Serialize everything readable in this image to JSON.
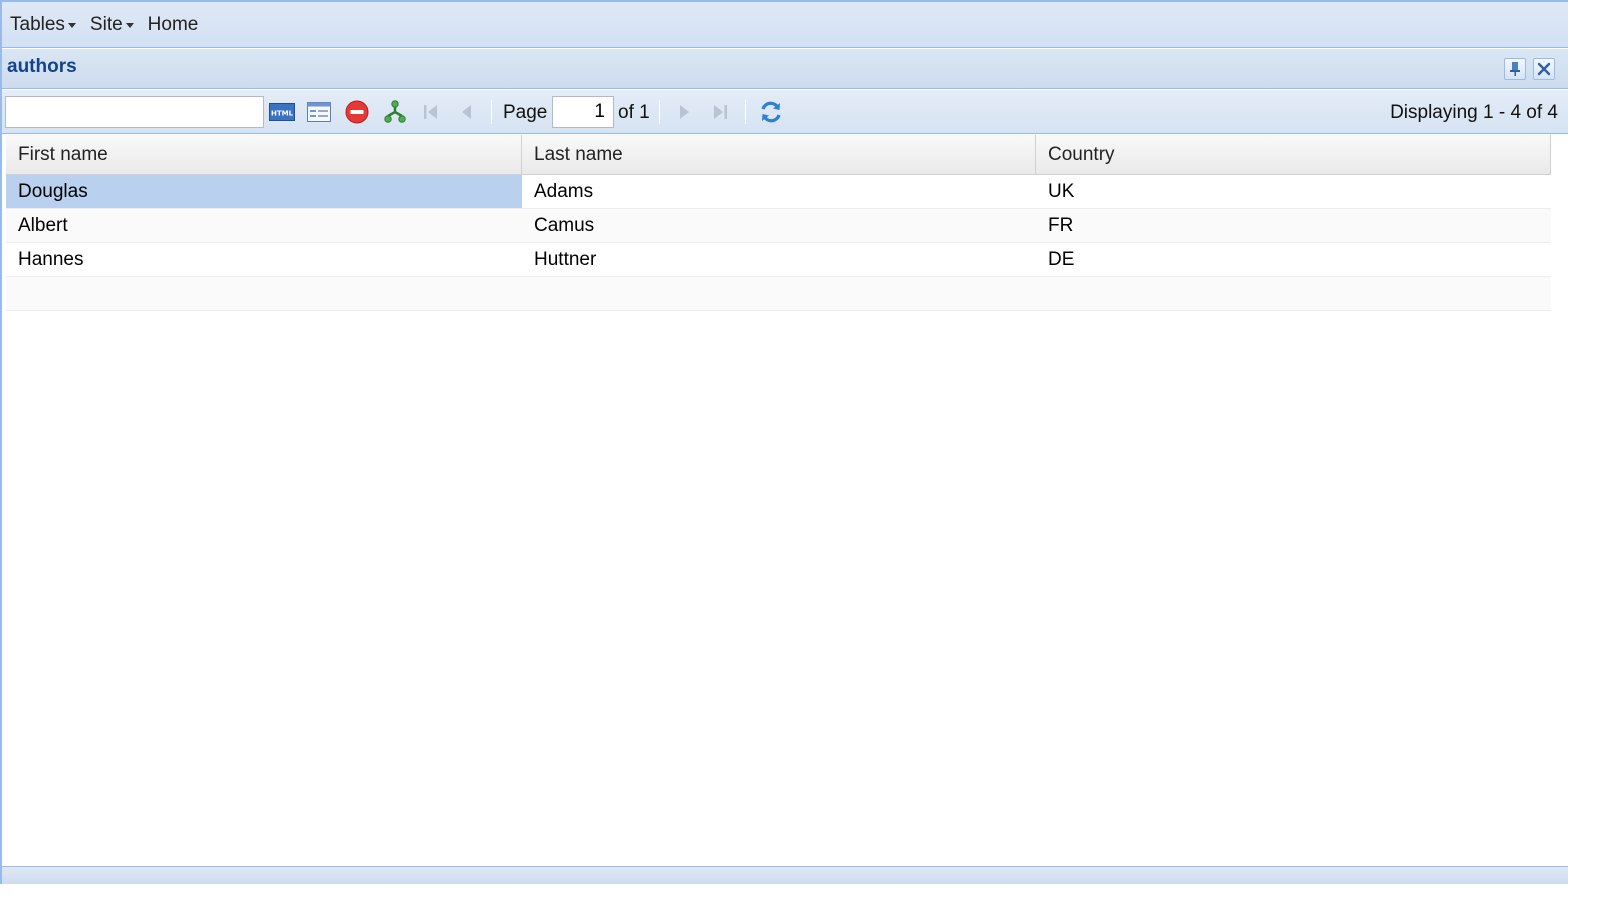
{
  "menubar": {
    "items": [
      {
        "label": "Tables",
        "has_dropdown": true
      },
      {
        "label": "Site",
        "has_dropdown": true
      },
      {
        "label": "Home",
        "has_dropdown": false
      }
    ]
  },
  "panel": {
    "title": "authors",
    "tools": [
      "pin-icon",
      "close-icon"
    ]
  },
  "toolbar": {
    "search_value": "",
    "icons": [
      "html-export-icon",
      "form-view-icon",
      "delete-icon",
      "tree-icon",
      "first-page-icon",
      "previous-page-icon",
      "next-page-icon",
      "last-page-icon",
      "refresh-icon"
    ],
    "page_label": "Page",
    "page_value": "1",
    "of_label": "of 1",
    "displaying": "Displaying 1 - 4 of 4"
  },
  "grid": {
    "columns": [
      "First name",
      "Last name",
      "Country"
    ],
    "rows": [
      {
        "first": "Douglas",
        "last": "Adams",
        "country": "UK"
      },
      {
        "first": "Albert",
        "last": "Camus",
        "country": "FR"
      },
      {
        "first": "Hannes",
        "last": "Huttner",
        "country": "DE"
      }
    ],
    "selected_row": 0
  },
  "colors": {
    "accent": "#15428b",
    "border": "#99bbe8",
    "selection": "#b9d0ee",
    "delete_red": "#e53935",
    "tree_green": "#4caf50"
  }
}
